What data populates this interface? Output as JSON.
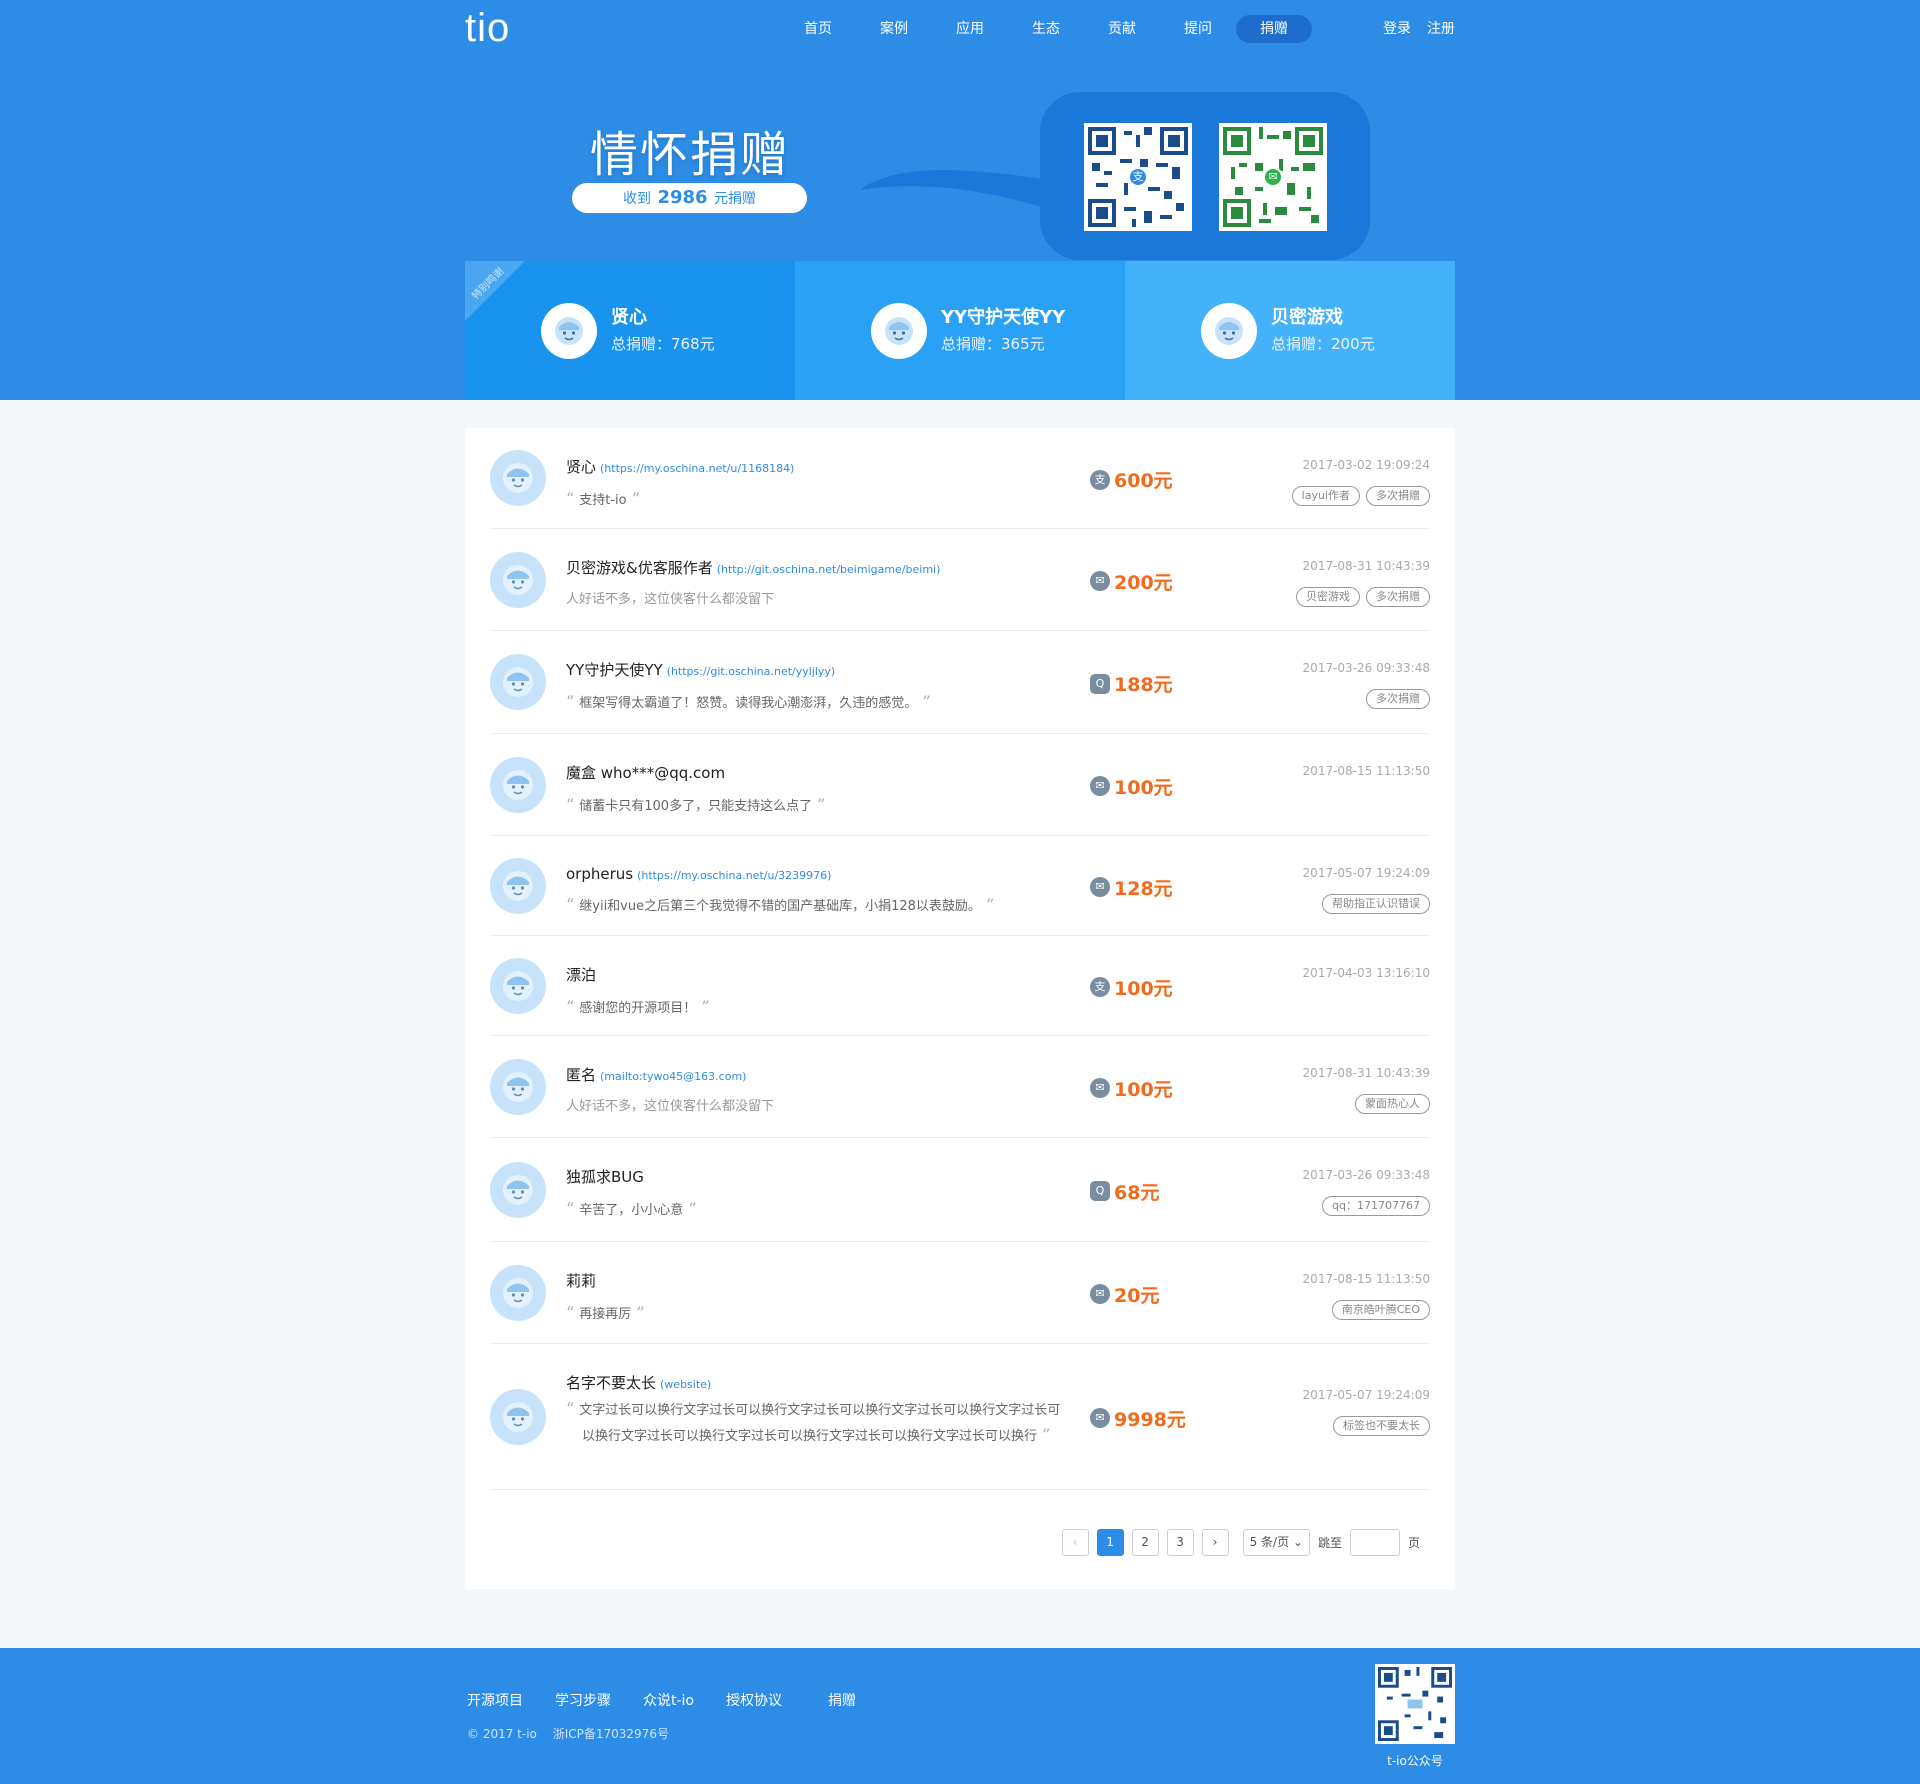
{
  "header": {
    "logo": "tio",
    "nav": [
      "首页",
      "案例",
      "应用",
      "生态",
      "贡献",
      "提问",
      "捐赠"
    ],
    "active_nav": "捐赠",
    "login": "登录",
    "register": "注册"
  },
  "hero": {
    "title": "情怀捐赠",
    "received_prefix": "收到",
    "received_amount": "2986",
    "received_suffix": "元捐赠",
    "qr_alipay_icon": "alipay-icon",
    "qr_wechat_icon": "wechat-icon"
  },
  "top_donors": {
    "ribbon": "特别鸣谢",
    "items": [
      {
        "name": "贤心",
        "total": "总捐赠：768元"
      },
      {
        "name": "YY守护天使YY",
        "total": "总捐赠：365元"
      },
      {
        "name": "贝密游戏",
        "total": "总捐赠：200元"
      }
    ]
  },
  "donations": [
    {
      "name": "贤心",
      "link": "(https://my.oschina.net/u/1168184)",
      "msg": "支持t-io",
      "quoted": true,
      "pay": "alipay",
      "amount": "600元",
      "time": "2017-03-02 19:09:24",
      "tags": [
        "layui作者",
        "多次捐赠"
      ]
    },
    {
      "name": "贝密游戏&优客服作者",
      "link": "(http://git.oschina.net/beimigame/beimi)",
      "msg": "人好话不多，这位侠客什么都没留下",
      "quoted": false,
      "pay": "wechat",
      "amount": "200元",
      "time": "2017-08-31 10:43:39",
      "tags": [
        "贝密游戏",
        "多次捐赠"
      ]
    },
    {
      "name": "YY守护天使YY",
      "link": "(https://git.oschina.net/yyljlyy)",
      "msg": "框架写得太霸道了！怒赞。读得我心潮澎湃，久违的感觉。",
      "quoted": true,
      "pay": "qq",
      "amount": "188元",
      "time": "2017-03-26 09:33:48",
      "tags": [
        "多次捐赠"
      ]
    },
    {
      "name": "魔盒 who***@qq.com",
      "link": "",
      "msg": "储蓄卡只有100多了，只能支持这么点了",
      "quoted": true,
      "pay": "wechat",
      "amount": "100元",
      "time": "2017-08-15 11:13:50",
      "tags": []
    },
    {
      "name": "orpherus",
      "link": "(https://my.oschina.net/u/3239976)",
      "msg": "继yii和vue之后第三个我觉得不错的国产基础库，小捐128以表鼓励。",
      "quoted": true,
      "pay": "wechat",
      "amount": "128元",
      "time": "2017-05-07 19:24:09",
      "tags": [
        "帮助指正认识错误"
      ]
    },
    {
      "name": "漂泊",
      "link": "",
      "msg": "感谢您的开源项目！",
      "quoted": true,
      "pay": "alipay",
      "amount": "100元",
      "time": "2017-04-03 13:16:10",
      "tags": []
    },
    {
      "name": "匿名",
      "link": "(mailto:tywo45@163.com)",
      "msg": "人好话不多，这位侠客什么都没留下",
      "quoted": false,
      "pay": "wechat",
      "amount": "100元",
      "time": "2017-08-31 10:43:39",
      "tags": [
        "蒙面热心人"
      ]
    },
    {
      "name": "独孤求BUG",
      "link": "",
      "msg": "辛苦了，小小心意",
      "quoted": true,
      "pay": "qq",
      "amount": "68元",
      "time": "2017-03-26 09:33:48",
      "tags": [
        "qq：171707767"
      ]
    },
    {
      "name": "莉莉",
      "link": "",
      "msg": "再接再厉",
      "quoted": true,
      "pay": "wechat",
      "amount": "20元",
      "time": "2017-08-15 11:13:50",
      "tags": [
        "南京皓叶腾CEO"
      ]
    },
    {
      "name": "名字不要太长",
      "link": "(website)",
      "msg": "文字过长可以换行文字过长可以换行文字过长可以换行文字过长可以换行文字过长可以换行文字过长可以换行文字过长可以换行文字过长可以换行文字过长可以换行",
      "quoted": true,
      "pay": "wechat",
      "amount": "9998元",
      "time": "2017-05-07 19:24:09",
      "tags": [
        "标签也不要太长"
      ]
    }
  ],
  "pagination": {
    "prev": "‹",
    "pages": [
      "1",
      "2",
      "3"
    ],
    "current": "1",
    "next": "›",
    "page_size": "5 条/页",
    "jump_label": "跳至",
    "jump_value": "",
    "page_unit": "页"
  },
  "footer": {
    "links": [
      "开源项目",
      "学习步骤",
      "众说t-io",
      "授权协议",
      "捐赠"
    ],
    "copyright": "© 2017 t-io",
    "icp": "浙ICP备17032976号",
    "qr_label": "t-io公众号"
  },
  "colors": {
    "brand": "#2d8ce6",
    "amount": "#f26a1b",
    "avatar_bg": "#c7e3fb"
  }
}
